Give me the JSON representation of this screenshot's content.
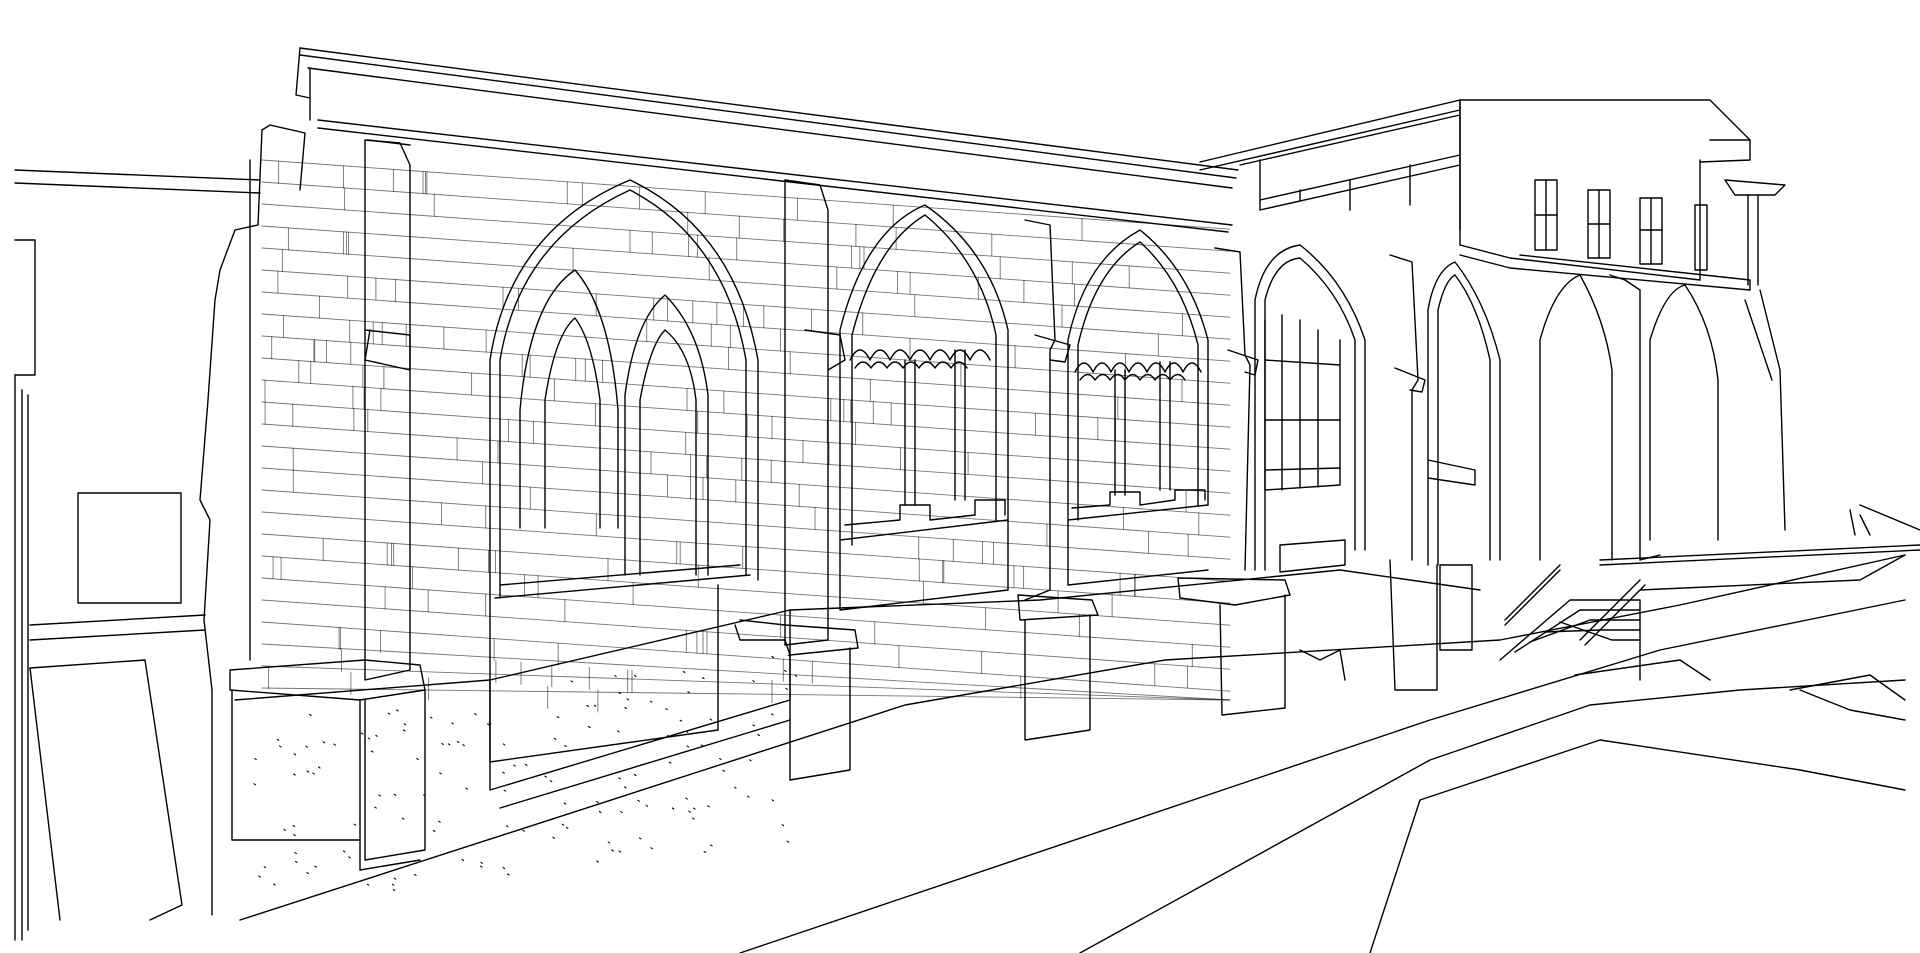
{
  "drawing": {
    "line_color": "#000000",
    "background_color": "#ffffff",
    "bays": [
      {
        "window_type": "twin lancet arch"
      },
      {
        "window_type": "trefoil tracery arch"
      },
      {
        "window_type": "trefoil tracery arch"
      },
      {
        "window_type": "glazed lancet arch"
      },
      {
        "window_type": "open lancet arch"
      }
    ]
  }
}
